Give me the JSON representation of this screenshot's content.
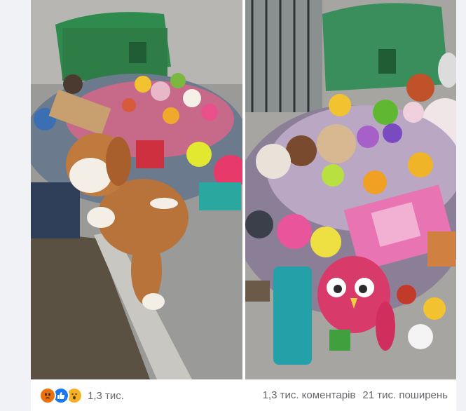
{
  "post": {
    "photos": [
      {
        "alt": "photo-left",
        "content": "pile of discarded plush toys next to green dumpster"
      },
      {
        "alt": "photo-right",
        "content": "pile of discarded plush toys and clothes near green dumpster"
      }
    ],
    "reactions": {
      "icons": [
        "angry-icon",
        "like-icon",
        "wow-icon"
      ],
      "count": "1,3 тис."
    },
    "stats": {
      "comments": "1,3 тис. коментарів",
      "shares": "21 тис. поширень"
    }
  }
}
